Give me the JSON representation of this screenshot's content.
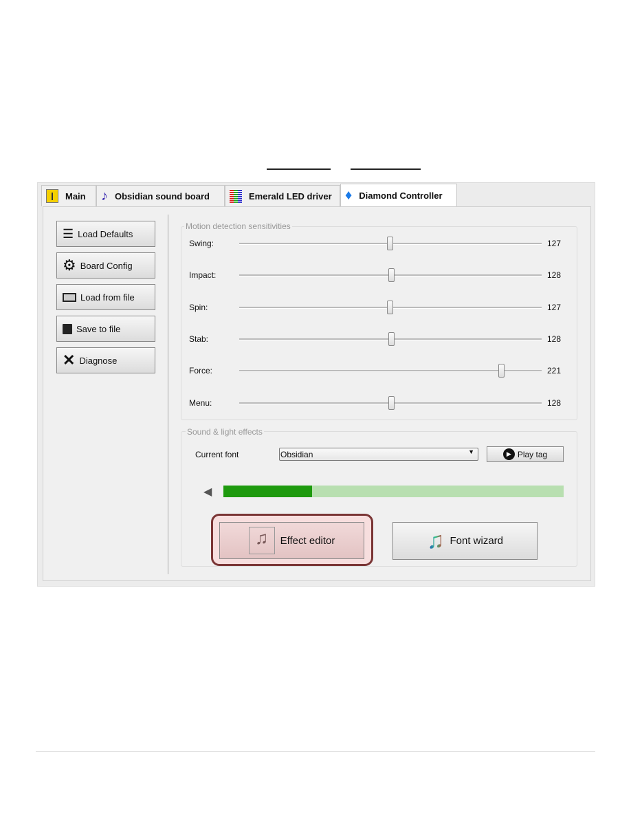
{
  "tabs": [
    {
      "label": "Main",
      "icon": "main-icon"
    },
    {
      "label": "Obsidian sound board",
      "icon": "music-note-icon"
    },
    {
      "label": "Emerald LED driver",
      "icon": "led-bars-icon"
    },
    {
      "label": "Diamond Controller",
      "icon": "diamond-icon",
      "active": true
    }
  ],
  "sidebar": {
    "buttons": [
      {
        "label": "Load Defaults",
        "icon": "sliders-icon"
      },
      {
        "label": "Board Config",
        "icon": "gear-icon"
      },
      {
        "label": "Load from file",
        "icon": "folder-open-icon"
      },
      {
        "label": "Save to file",
        "icon": "floppy-icon"
      },
      {
        "label": "Diagnose",
        "icon": "tools-icon"
      }
    ]
  },
  "motion": {
    "title": "Motion detection sensitivities",
    "max": 255,
    "sliders": [
      {
        "label": "Swing:",
        "value": 127
      },
      {
        "label": "Impact:",
        "value": 128
      },
      {
        "label": "Spin:",
        "value": 127
      },
      {
        "label": "Stab:",
        "value": 128
      },
      {
        "label": "Force:",
        "value": 221
      },
      {
        "label": "Menu:",
        "value": 128
      }
    ]
  },
  "effects": {
    "title": "Sound & light effects",
    "current_font_label": "Current font",
    "current_font": "Obsidian",
    "play_tag": "Play tag",
    "volume_percent": 26,
    "effect_editor": "Effect editor",
    "font_wizard": "Font wizard",
    "highlight_color": "#7a3535",
    "volume_color": "#1e9a0e",
    "volume_bg": "#b8dfb0"
  }
}
